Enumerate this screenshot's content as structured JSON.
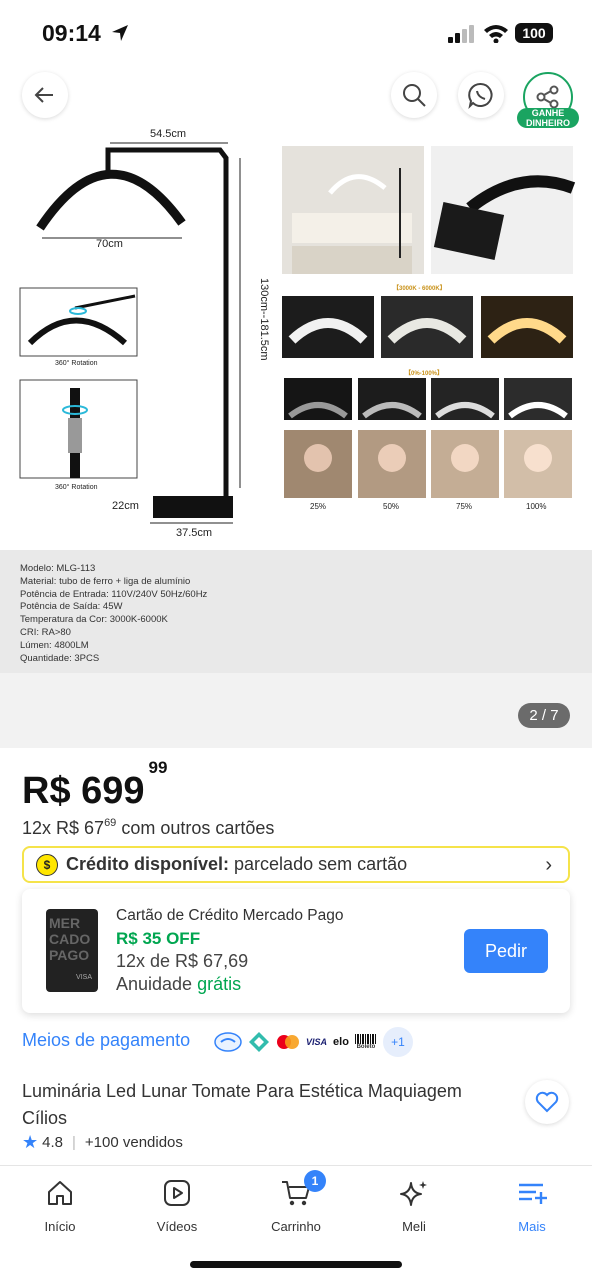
{
  "status_bar": {
    "time": "09:14",
    "battery": "100"
  },
  "gallery": {
    "counter": "2 / 7",
    "share_badge": "GANHE DINHEIRO",
    "dims": {
      "top": "54.5cm",
      "arc": "70cm",
      "height": "130cm--181.5cm",
      "base_h": "22cm",
      "base_w": "37.5cm"
    },
    "rotation_label": "360° Rotation",
    "color_temp_label": "【3000K - 6000K】",
    "brightness_label": "【0%-100%】",
    "brightness_levels": [
      "25%",
      "50%",
      "75%",
      "100%"
    ],
    "specs": [
      "Modelo: MLG-113",
      "Material: tubo de ferro + liga de alumínio",
      "Potência de Entrada: 110V/240V 50Hz/60Hz",
      "Potência de Saída: 45W",
      "Temperatura da Cor: 3000K-6000K",
      "CRI: RA>80",
      "Lúmen: 4800LM",
      "Quantidade: 3PCS"
    ]
  },
  "price": {
    "currency": "R$",
    "integer": "699",
    "cents": "99"
  },
  "installment": {
    "prefix": "12x R$ 67",
    "cents": "69",
    "suffix": "com outros cartões"
  },
  "credit_banner": {
    "bold": "Crédito disponível:",
    "rest": "parcelado sem cartão"
  },
  "card_offer": {
    "card_text": "MER CADO PAGO",
    "card_brand": "VISA",
    "title": "Cartão de Crédito Mercado Pago",
    "discount": "R$ 35 OFF",
    "installments": "12x de R$ 67,69",
    "annuity_label": "Anuidade",
    "annuity_value": "grátis",
    "button": "Pedir"
  },
  "payment": {
    "label": "Meios de pagamento",
    "visa": "VISA",
    "elo": "elo",
    "boleto": "Boleto",
    "more": "+1"
  },
  "product": {
    "title": "Luminária Led Lunar Tomate Para Estética Maquiagem Cílios",
    "rating": "4.8",
    "sold": "+100 vendidos"
  },
  "tabs": [
    {
      "label": "Início"
    },
    {
      "label": "Vídeos"
    },
    {
      "label": "Carrinho",
      "badge": "1"
    },
    {
      "label": "Meli"
    },
    {
      "label": "Mais"
    }
  ],
  "colors": {
    "accent": "#3483fa",
    "green": "#00a650",
    "yellow": "#ffe600"
  }
}
